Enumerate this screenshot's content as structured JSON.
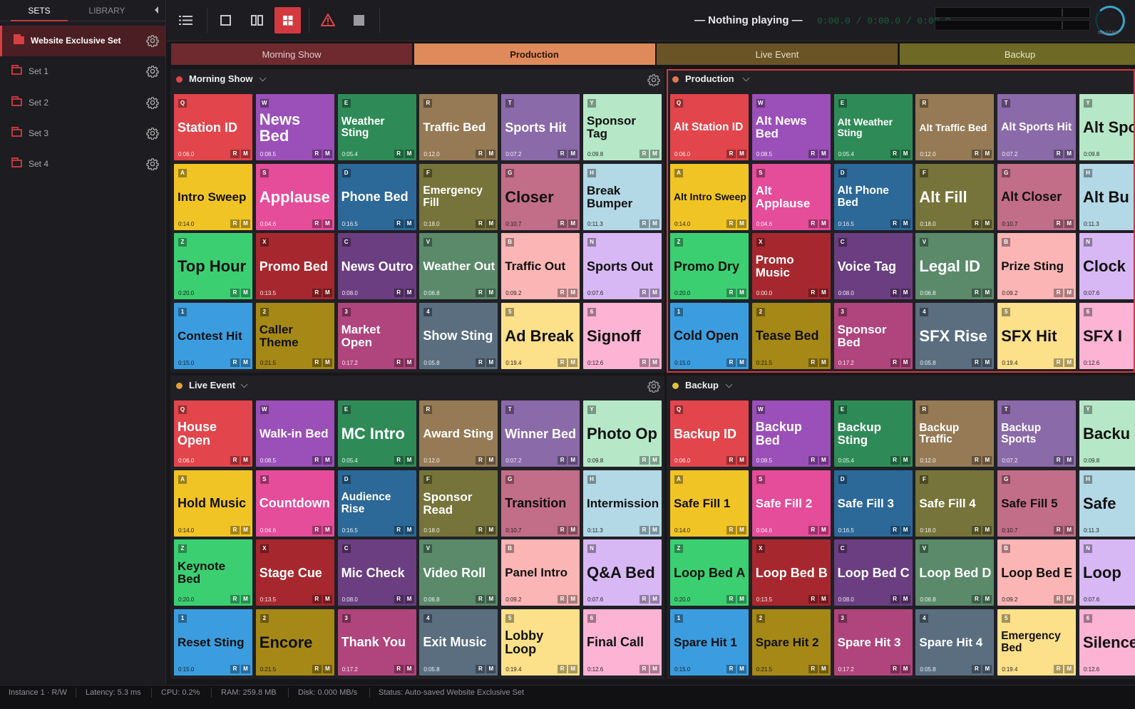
{
  "sidebar": {
    "tabs": {
      "sets": "SETS",
      "library": "LIBRARY"
    },
    "sets": [
      {
        "label": "Website Exclusive Set",
        "active": true
      },
      {
        "label": "Set 1"
      },
      {
        "label": "Set 2"
      },
      {
        "label": "Set 3"
      },
      {
        "label": "Set 4"
      }
    ]
  },
  "toolbar": {
    "now_playing": "— Nothing playing —",
    "time": "0:00.0 / 0:00.0 / 0:00.0",
    "master_label": "MASTER"
  },
  "page_tabs": [
    {
      "label": "Morning Show",
      "bg": "#6e2a2e",
      "fg": "#e3c8ca"
    },
    {
      "label": "Production",
      "bg": "#e08a5c",
      "fg": "#2b1609",
      "active": true
    },
    {
      "label": "Live Event",
      "bg": "#6a5426",
      "fg": "#e6dcc6"
    },
    {
      "label": "Backup",
      "bg": "#6e6a26",
      "fg": "#e8e6c8"
    }
  ],
  "panels": [
    {
      "title": "Morning Show",
      "dot": "#e0454a",
      "gear": true,
      "pads": [
        [
          "Q",
          "Station ID",
          "0:06.0"
        ],
        [
          "W",
          "News Bed",
          "0:08.5"
        ],
        [
          "E",
          "Weather Sting",
          "0:05.4"
        ],
        [
          "R",
          "Traffic Bed",
          "0:12.0"
        ],
        [
          "T",
          "Sports Hit",
          "0:07.2"
        ],
        [
          "Y",
          "Sponsor Tag",
          "0:09.8"
        ],
        [
          "A",
          "Intro Sweep",
          "0:14.0"
        ],
        [
          "S",
          "Applause",
          "0:04.6"
        ],
        [
          "D",
          "Phone Bed",
          "0:16.5"
        ],
        [
          "F",
          "Emergency Fill",
          "0:18.0"
        ],
        [
          "G",
          "Closer",
          "0:10.7"
        ],
        [
          "H",
          "Break Bumper",
          "0:11.3"
        ],
        [
          "Z",
          "Top Hour",
          "0:20.0"
        ],
        [
          "X",
          "Promo Bed",
          "0:13.5"
        ],
        [
          "C",
          "News Outro",
          "0:08.0"
        ],
        [
          "V",
          "Weather Out",
          "0:06.8"
        ],
        [
          "B",
          "Traffic Out",
          "0:09.2"
        ],
        [
          "N",
          "Sports Out",
          "0:07.6"
        ],
        [
          "1",
          "Contest Hit",
          "0:15.0"
        ],
        [
          "2",
          "Caller Theme",
          "0:21.5"
        ],
        [
          "3",
          "Market Open",
          "0:17.2"
        ],
        [
          "4",
          "Show Sting",
          "0:05.8"
        ],
        [
          "5",
          "Ad Break",
          "0:19.4"
        ],
        [
          "6",
          "Signoff",
          "0:12.6"
        ]
      ]
    },
    {
      "title": "Production",
      "dot": "#e07a4a",
      "gear": false,
      "pads": [
        [
          "Q",
          "Alt Station ID",
          "0:06.0"
        ],
        [
          "W",
          "Alt News Bed",
          "0:08.5"
        ],
        [
          "E",
          "Alt Weather Sting",
          "0:05.4"
        ],
        [
          "R",
          "Alt Traffic Bed",
          "0:12.0"
        ],
        [
          "T",
          "Alt Sports Hit",
          "0:07.2"
        ],
        [
          "Y",
          "Alt Spon",
          "0:09.8"
        ],
        [
          "A",
          "Alt Intro Sweep",
          "0:14.0"
        ],
        [
          "S",
          "Alt Applause",
          "0:04.6"
        ],
        [
          "D",
          "Alt Phone Bed",
          "0:16.5"
        ],
        [
          "F",
          "Alt Fill",
          "0:18.0"
        ],
        [
          "G",
          "Alt Closer",
          "0:10.7"
        ],
        [
          "H",
          "Alt Bu",
          "0:11.3"
        ],
        [
          "Z",
          "Promo Dry",
          "0:20.0"
        ],
        [
          "X",
          "Promo Music",
          "0:00.0"
        ],
        [
          "C",
          "Voice Tag",
          "0:08.0"
        ],
        [
          "V",
          "Legal ID",
          "0:06.8"
        ],
        [
          "B",
          "Prize Sting",
          "0:09.2"
        ],
        [
          "N",
          "Clock",
          "0:07.6"
        ],
        [
          "1",
          "Cold Open",
          "0:15.0"
        ],
        [
          "2",
          "Tease Bed",
          "0:21.5"
        ],
        [
          "3",
          "Sponsor Bed",
          "0:17.2"
        ],
        [
          "4",
          "SFX Rise",
          "0:05.8"
        ],
        [
          "5",
          "SFX Hit",
          "0:19.4"
        ],
        [
          "6",
          "SFX I",
          "0:12.6"
        ]
      ]
    },
    {
      "title": "Live Event",
      "dot": "#e0a03a",
      "gear": true,
      "pads": [
        [
          "Q",
          "House Open",
          "0:06.0"
        ],
        [
          "W",
          "Walk-in Bed",
          "0:08.5"
        ],
        [
          "E",
          "MC Intro",
          "0:05.4"
        ],
        [
          "R",
          "Award Sting",
          "0:12.0"
        ],
        [
          "T",
          "Winner Bed",
          "0:07.2"
        ],
        [
          "Y",
          "Photo Op",
          "0:09.8"
        ],
        [
          "A",
          "Hold Music",
          "0:14.0"
        ],
        [
          "S",
          "Countdown",
          "0:04.6"
        ],
        [
          "D",
          "Audience Rise",
          "0:16.5"
        ],
        [
          "F",
          "Sponsor Read",
          "0:18.0"
        ],
        [
          "G",
          "Transition",
          "0:10.7"
        ],
        [
          "H",
          "Intermission",
          "0:11.3"
        ],
        [
          "Z",
          "Keynote Bed",
          "0:20.0"
        ],
        [
          "X",
          "Stage Cue",
          "0:13.5"
        ],
        [
          "C",
          "Mic Check",
          "0:08.0"
        ],
        [
          "V",
          "Video Roll",
          "0:06.8"
        ],
        [
          "B",
          "Panel Intro",
          "0:09.2"
        ],
        [
          "N",
          "Q&A Bed",
          "0:07.6"
        ],
        [
          "1",
          "Reset Sting",
          "0:15.0"
        ],
        [
          "2",
          "Encore",
          "0:21.5"
        ],
        [
          "3",
          "Thank You",
          "0:17.2"
        ],
        [
          "4",
          "Exit Music",
          "0:05.8"
        ],
        [
          "5",
          "Lobby Loop",
          "0:19.4"
        ],
        [
          "6",
          "Final Call",
          "0:12.6"
        ]
      ]
    },
    {
      "title": "Backup",
      "dot": "#e0c23a",
      "gear": false,
      "pads": [
        [
          "Q",
          "Backup ID",
          "0:06.0"
        ],
        [
          "W",
          "Backup Bed",
          "0:08.5"
        ],
        [
          "E",
          "Backup Sting",
          "0:05.4"
        ],
        [
          "R",
          "Backup Traffic",
          "0:12.0"
        ],
        [
          "T",
          "Backup Sports",
          "0:07.2"
        ],
        [
          "Y",
          "Backu",
          "0:09.8"
        ],
        [
          "A",
          "Safe Fill 1",
          "0:14.0"
        ],
        [
          "S",
          "Safe Fill 2",
          "0:04.6"
        ],
        [
          "D",
          "Safe Fill 3",
          "0:16.5"
        ],
        [
          "F",
          "Safe Fill 4",
          "0:18.0"
        ],
        [
          "G",
          "Safe Fill 5",
          "0:10.7"
        ],
        [
          "H",
          "Safe",
          "0:11.3"
        ],
        [
          "Z",
          "Loop Bed A",
          "0:20.0"
        ],
        [
          "X",
          "Loop Bed B",
          "0:13.5"
        ],
        [
          "C",
          "Loop Bed C",
          "0:08.0"
        ],
        [
          "V",
          "Loop Bed D",
          "0:06.8"
        ],
        [
          "B",
          "Loop Bed E",
          "0:09.2"
        ],
        [
          "N",
          "Loop",
          "0:07.6"
        ],
        [
          "1",
          "Spare Hit 1",
          "0:15.0"
        ],
        [
          "2",
          "Spare Hit 2",
          "0:21.5"
        ],
        [
          "3",
          "Spare Hit 3",
          "0:17.2"
        ],
        [
          "4",
          "Spare Hit 4",
          "0:05.8"
        ],
        [
          "5",
          "Emergency Bed",
          "0:19.4"
        ],
        [
          "6",
          "Silence",
          "0:12.6"
        ]
      ]
    }
  ],
  "pad_colors": [
    [
      "#e2454b",
      "#fff"
    ],
    [
      "#9b4fb8",
      "#fff"
    ],
    [
      "#2e8b57",
      "#fff"
    ],
    [
      "#957a55",
      "#fff"
    ],
    [
      "#8a6aa8",
      "#fff"
    ],
    [
      "#b6e8c8",
      "#111"
    ],
    [
      "#f1c425",
      "#111"
    ],
    [
      "#e54c9a",
      "#fff"
    ],
    [
      "#2c6898",
      "#fff"
    ],
    [
      "#76743a",
      "#fff"
    ],
    [
      "#c26e88",
      "#111"
    ],
    [
      "#b3d8e6",
      "#111"
    ],
    [
      "#3ccf72",
      "#111"
    ],
    [
      "#a6282e",
      "#fff"
    ],
    [
      "#6a3e80",
      "#fff"
    ],
    [
      "#5a8a6a",
      "#fff"
    ],
    [
      "#fcb5b5",
      "#111"
    ],
    [
      "#d8b8f4",
      "#111"
    ],
    [
      "#3b9de0",
      "#111"
    ],
    [
      "#a68816",
      "#111"
    ],
    [
      "#b0447c",
      "#fff"
    ],
    [
      "#5a6e80",
      "#fff"
    ],
    [
      "#fce08a",
      "#111"
    ],
    [
      "#fcb3d4",
      "#111"
    ]
  ],
  "status": {
    "instance": "Instance 1 · R/W",
    "latency": "Latency: 5.3 ms",
    "cpu": "CPU: 0.2%",
    "ram": "RAM: 259.8 MB",
    "disk": "Disk: 0.000 MB/s",
    "status": "Status: Auto-saved Website Exclusive Set"
  }
}
